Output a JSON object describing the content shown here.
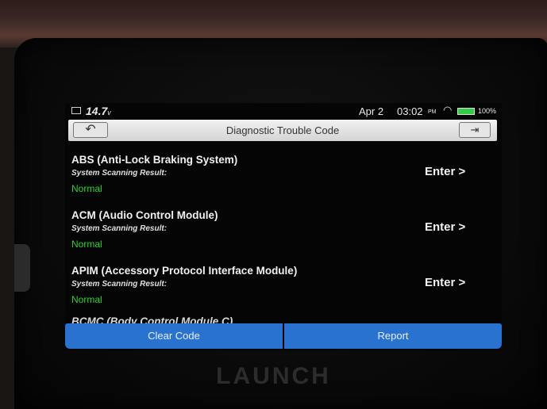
{
  "brand": "LAUNCH",
  "statusbar": {
    "voltage_value": "14.7",
    "voltage_unit": "v",
    "date": "Apr 2",
    "time": "03:02",
    "ampm": "PM",
    "battery": "100%",
    "icons": [
      "gallery-icon",
      "wifi-icon",
      "battery-icon"
    ],
    "battery_color": "#33cc44"
  },
  "titlebar": {
    "title": "Diagnostic Trouble Code",
    "back_icon": "↶",
    "exit_icon": "⇥"
  },
  "systems": [
    {
      "name": "ABS (Anti-Lock Braking System)",
      "result_label": "System Scanning Result:",
      "result_value": "Normal",
      "enter_label": "Enter >"
    },
    {
      "name": "ACM (Audio Control Module)",
      "result_label": "System Scanning Result:",
      "result_value": "Normal",
      "enter_label": "Enter >"
    },
    {
      "name": "APIM (Accessory Protocol Interface Module)",
      "result_label": "System Scanning Result:",
      "result_value": "Normal",
      "enter_label": "Enter >"
    }
  ],
  "partial_row": "BCMC (Body Control Module C)",
  "footer": {
    "clear_code": "Clear Code",
    "report": "Report"
  },
  "colors": {
    "normal_status": "#2fd02f",
    "button_blue": "#2a72cf"
  }
}
